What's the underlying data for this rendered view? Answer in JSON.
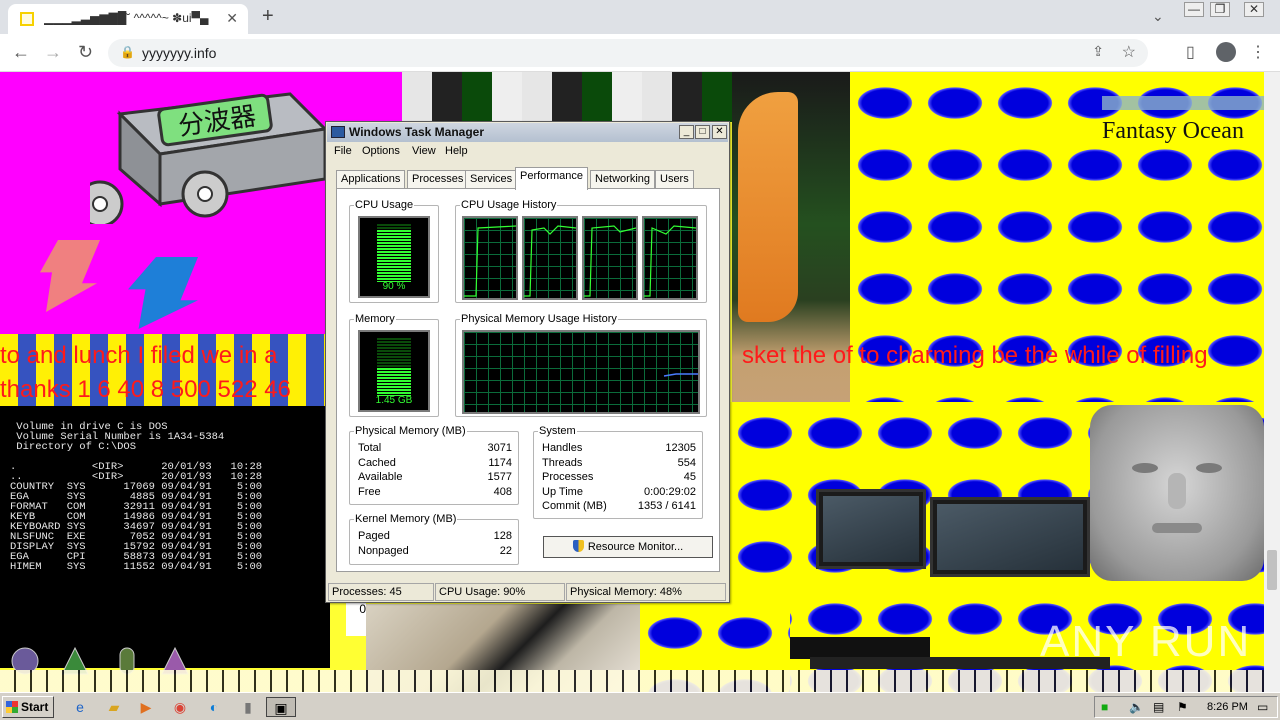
{
  "browser": {
    "tab_title": "▁▁▁▂▃▅▆▇█˘ ^^^^^~ ✽ui▀▄",
    "tab_close": "✕",
    "new_tab": "+",
    "url": "yyyyyyy.info",
    "window_min": "—",
    "window_max": "❐",
    "window_close": "✕"
  },
  "page": {
    "fantasy_title": "Fantasy Ocean",
    "red_line1_left": "to and lunch I filed we in a",
    "red_line1_right": "sket the of to charming be the while of filling",
    "red_line2": "thanks 1 6 40 8 500 522 46",
    "dos_listing": " Volume in drive C is DOS\n Volume Serial Number is 1A34-5384\n Directory of C:\\DOS\n\n.            <DIR>      20/01/93   10:28\n..           <DIR>      20/01/93   10:28\nCOUNTRY  SYS      17069 09/04/91    5:00\nEGA      SYS       4885 09/04/91    5:00\nFORMAT   COM      32911 09/04/91    5:00\nKEYB     COM      14986 09/04/91    5:00\nKEYBOARD SYS      34697 09/04/91    5:00\nNLSFUNC  EXE       7052 09/04/91    5:00\nDISPLAY  SYS      15792 09/04/91    5:00\nEGA      CPI      58873 09/04/91    5:00\nHIMEM    SYS      11552 09/04/91    5:00",
    "watermark": "ANY RUN",
    "splitter_label": "分波器",
    "stray_char": "0"
  },
  "taskmgr": {
    "title": "Windows Task Manager",
    "menus": [
      "File",
      "Options",
      "View",
      "Help"
    ],
    "tabs": [
      "Applications",
      "Processes",
      "Services",
      "Performance",
      "Networking",
      "Users"
    ],
    "active_tab": "Performance",
    "cpu_usage_label": "CPU Usage",
    "cpu_usage_value": "90 %",
    "cpu_fraction": 0.9,
    "cpu_history_label": "CPU Usage History",
    "memory_label": "Memory",
    "memory_value": "1.45 GB",
    "memory_fraction": 0.48,
    "phys_history_label": "Physical Memory Usage History",
    "physical_memory": {
      "title": "Physical Memory (MB)",
      "rows": [
        {
          "k": "Total",
          "v": "3071"
        },
        {
          "k": "Cached",
          "v": "1174"
        },
        {
          "k": "Available",
          "v": "1577"
        },
        {
          "k": "Free",
          "v": "408"
        }
      ]
    },
    "kernel_memory": {
      "title": "Kernel Memory (MB)",
      "rows": [
        {
          "k": "Paged",
          "v": "128"
        },
        {
          "k": "Nonpaged",
          "v": "22"
        }
      ]
    },
    "system": {
      "title": "System",
      "rows": [
        {
          "k": "Handles",
          "v": "12305"
        },
        {
          "k": "Threads",
          "v": "554"
        },
        {
          "k": "Processes",
          "v": "45"
        },
        {
          "k": "Up Time",
          "v": "0:00:29:02"
        },
        {
          "k": "Commit (MB)",
          "v": "1353 / 6141"
        }
      ]
    },
    "resource_monitor_button": "Resource Monitor...",
    "status": {
      "processes": "Processes: 45",
      "cpu": "CPU Usage: 90%",
      "memory": "Physical Memory: 48%"
    }
  },
  "taskbar": {
    "start_label": "Start",
    "clock": "8:26 PM"
  },
  "colors": {
    "meter_green": "#33ff33",
    "graph_grid": "#0b6b3a",
    "mem_line": "#4a7cff",
    "red_text": "#ff1a1a"
  }
}
